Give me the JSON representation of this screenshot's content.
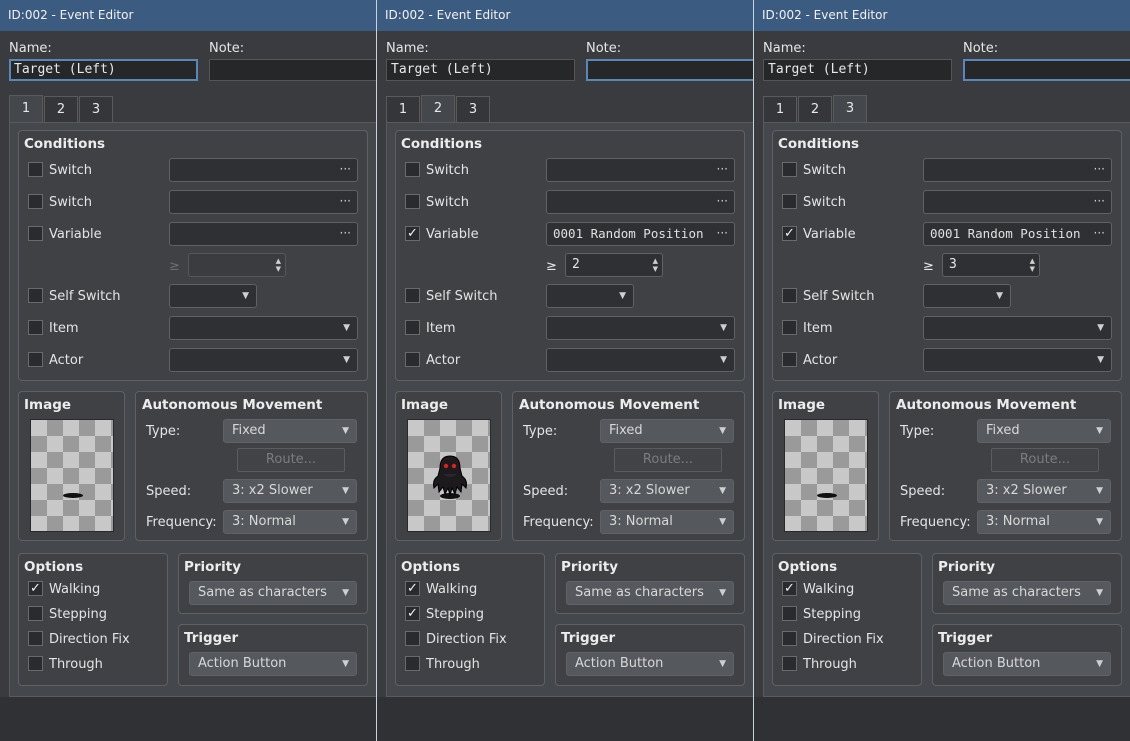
{
  "windows": [
    {
      "title": "ID:002 - Event Editor",
      "name_label": "Name:",
      "name_value": "Target (Left)",
      "note_label": "Note:",
      "note_value": "",
      "tabs": [
        "1",
        "2",
        "3"
      ],
      "active_tab": 0,
      "conditions": {
        "title": "Conditions",
        "switch1_label": "Switch",
        "switch1_checked": false,
        "switch1_value": "",
        "switch2_label": "Switch",
        "switch2_checked": false,
        "switch2_value": "",
        "variable_label": "Variable",
        "variable_checked": false,
        "variable_value": "",
        "ge_symbol": "≥",
        "variable_compare": "",
        "selfswitch_label": "Self Switch",
        "selfswitch_checked": false,
        "selfswitch_value": "",
        "item_label": "Item",
        "item_checked": false,
        "item_value": "",
        "actor_label": "Actor",
        "actor_checked": false,
        "actor_value": ""
      },
      "image": {
        "title": "Image",
        "sprite": "shadow-only"
      },
      "movement": {
        "title": "Autonomous Movement",
        "type_label": "Type:",
        "type_value": "Fixed",
        "route_label": "Route...",
        "speed_label": "Speed:",
        "speed_value": "3: x2 Slower",
        "frequency_label": "Frequency:",
        "frequency_value": "3: Normal"
      },
      "options": {
        "title": "Options",
        "walking_label": "Walking",
        "walking_checked": true,
        "stepping_label": "Stepping",
        "stepping_checked": false,
        "dirfix_label": "Direction Fix",
        "dirfix_checked": false,
        "through_label": "Through",
        "through_checked": false
      },
      "priority": {
        "title": "Priority",
        "value": "Same as characters"
      },
      "trigger": {
        "title": "Trigger",
        "value": "Action Button"
      }
    },
    {
      "title": "ID:002 - Event Editor",
      "name_label": "Name:",
      "name_value": "Target (Left)",
      "note_label": "Note:",
      "note_value": "",
      "tabs": [
        "1",
        "2",
        "3"
      ],
      "active_tab": 1,
      "conditions": {
        "title": "Conditions",
        "switch1_label": "Switch",
        "switch1_checked": false,
        "switch1_value": "",
        "switch2_label": "Switch",
        "switch2_checked": false,
        "switch2_value": "",
        "variable_label": "Variable",
        "variable_checked": true,
        "variable_value": "0001 Random Position",
        "ge_symbol": "≥",
        "variable_compare": "2",
        "selfswitch_label": "Self Switch",
        "selfswitch_checked": false,
        "selfswitch_value": "",
        "item_label": "Item",
        "item_checked": false,
        "item_value": "",
        "actor_label": "Actor",
        "actor_checked": false,
        "actor_value": ""
      },
      "image": {
        "title": "Image",
        "sprite": "dark-ghost"
      },
      "movement": {
        "title": "Autonomous Movement",
        "type_label": "Type:",
        "type_value": "Fixed",
        "route_label": "Route...",
        "speed_label": "Speed:",
        "speed_value": "3: x2 Slower",
        "frequency_label": "Frequency:",
        "frequency_value": "3: Normal"
      },
      "options": {
        "title": "Options",
        "walking_label": "Walking",
        "walking_checked": true,
        "stepping_label": "Stepping",
        "stepping_checked": true,
        "dirfix_label": "Direction Fix",
        "dirfix_checked": false,
        "through_label": "Through",
        "through_checked": false
      },
      "priority": {
        "title": "Priority",
        "value": "Same as characters"
      },
      "trigger": {
        "title": "Trigger",
        "value": "Action Button"
      }
    },
    {
      "title": "ID:002 - Event Editor",
      "name_label": "Name:",
      "name_value": "Target (Left)",
      "note_label": "Note:",
      "note_value": "",
      "tabs": [
        "1",
        "2",
        "3"
      ],
      "active_tab": 2,
      "conditions": {
        "title": "Conditions",
        "switch1_label": "Switch",
        "switch1_checked": false,
        "switch1_value": "",
        "switch2_label": "Switch",
        "switch2_checked": false,
        "switch2_value": "",
        "variable_label": "Variable",
        "variable_checked": true,
        "variable_value": "0001 Random Position",
        "ge_symbol": "≥",
        "variable_compare": "3",
        "selfswitch_label": "Self Switch",
        "selfswitch_checked": false,
        "selfswitch_value": "",
        "item_label": "Item",
        "item_checked": false,
        "item_value": "",
        "actor_label": "Actor",
        "actor_checked": false,
        "actor_value": ""
      },
      "image": {
        "title": "Image",
        "sprite": "shadow-only"
      },
      "movement": {
        "title": "Autonomous Movement",
        "type_label": "Type:",
        "type_value": "Fixed",
        "route_label": "Route...",
        "speed_label": "Speed:",
        "speed_value": "3: x2 Slower",
        "frequency_label": "Frequency:",
        "frequency_value": "3: Normal"
      },
      "options": {
        "title": "Options",
        "walking_label": "Walking",
        "walking_checked": true,
        "stepping_label": "Stepping",
        "stepping_checked": false,
        "dirfix_label": "Direction Fix",
        "dirfix_checked": false,
        "through_label": "Through",
        "through_checked": false
      },
      "priority": {
        "title": "Priority",
        "value": "Same as characters"
      },
      "trigger": {
        "title": "Trigger",
        "value": "Action Button"
      }
    }
  ],
  "check_glyph": "✓",
  "colors": {
    "titlebar": "#3c5b80",
    "panel": "#44474b",
    "focus_border": "#5a86b8"
  }
}
